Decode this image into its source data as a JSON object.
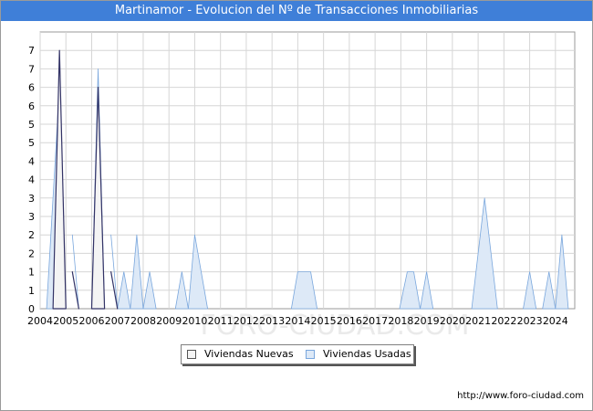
{
  "header": {
    "title": "Martinamor - Evolucion del Nº de Transacciones Inmobiliarias"
  },
  "footer": {
    "url": "http://www.foro-ciudad.com"
  },
  "watermark": "FORO-CIUDAD.COM",
  "colors": {
    "title_bg": "#3f7fd8",
    "nuevas_fill": "#f4f4f4",
    "nuevas_line": "#333366",
    "usadas_fill": "#dde9f7",
    "usadas_line": "#7aa7dd"
  },
  "chart_data": {
    "type": "area",
    "title": "Martinamor - Evolucion del Nº de Transacciones Inmobiliarias",
    "xlabel": "",
    "ylabel": "",
    "x_ticks": [
      "2004",
      "2005",
      "2006",
      "2007",
      "2008",
      "2009",
      "2010",
      "2011",
      "2012",
      "2013",
      "2014",
      "2015",
      "2016",
      "2017",
      "2018",
      "2019",
      "2020",
      "2021",
      "2022",
      "2023",
      "2024"
    ],
    "y_ticks": [
      "0",
      "1",
      "1",
      "2",
      "2",
      "3",
      "3",
      "4",
      "4",
      "5",
      "5",
      "6",
      "6",
      "7",
      "7"
    ],
    "ylim": [
      0,
      7.5
    ],
    "grid": true,
    "legend_position": "bottom",
    "series": [
      {
        "name": "Viviendas Nuevas",
        "points": [
          [
            2004.5,
            0
          ],
          [
            2004.75,
            7
          ],
          [
            2005.0,
            0
          ],
          [
            2005.25,
            1
          ],
          [
            2005.5,
            0
          ],
          [
            2006.0,
            0
          ],
          [
            2006.25,
            6
          ],
          [
            2006.5,
            0
          ],
          [
            2006.75,
            1
          ],
          [
            2007.0,
            0
          ]
        ]
      },
      {
        "name": "Viviendas Usadas",
        "points": [
          [
            2004.25,
            0
          ],
          [
            2004.75,
            6
          ],
          [
            2005.0,
            0
          ],
          [
            2005.25,
            2
          ],
          [
            2005.5,
            0
          ],
          [
            2006.0,
            0
          ],
          [
            2006.25,
            6.5
          ],
          [
            2006.5,
            0
          ],
          [
            2006.75,
            2
          ],
          [
            2007.0,
            0
          ],
          [
            2007.0,
            0
          ],
          [
            2007.25,
            1
          ],
          [
            2007.5,
            0
          ],
          [
            2007.5,
            0
          ],
          [
            2007.75,
            2
          ],
          [
            2008.0,
            0
          ],
          [
            2008.0,
            0
          ],
          [
            2008.25,
            1
          ],
          [
            2008.5,
            0
          ],
          [
            2009.25,
            0
          ],
          [
            2009.5,
            1
          ],
          [
            2009.75,
            0
          ],
          [
            2009.75,
            0
          ],
          [
            2010.0,
            2
          ],
          [
            2010.5,
            0
          ],
          [
            2013.75,
            0
          ],
          [
            2014.0,
            1
          ],
          [
            2014.5,
            1
          ],
          [
            2014.75,
            0
          ],
          [
            2017.95,
            0
          ],
          [
            2018.25,
            1
          ],
          [
            2018.5,
            1
          ],
          [
            2018.75,
            0
          ],
          [
            2018.75,
            0
          ],
          [
            2019.0,
            1
          ],
          [
            2019.25,
            0
          ],
          [
            2020.75,
            0
          ],
          [
            2021.25,
            3
          ],
          [
            2021.75,
            0
          ],
          [
            2022.75,
            0
          ],
          [
            2023.0,
            1
          ],
          [
            2023.25,
            0
          ],
          [
            2023.5,
            0
          ],
          [
            2023.75,
            1
          ],
          [
            2024.0,
            0
          ],
          [
            2024.0,
            0
          ],
          [
            2024.25,
            2
          ],
          [
            2024.5,
            0
          ]
        ]
      }
    ]
  }
}
